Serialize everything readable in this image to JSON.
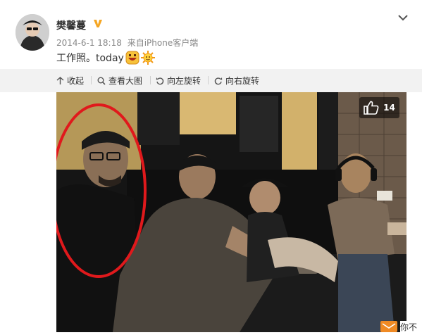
{
  "post": {
    "username": "樊馨蔓",
    "timestamp": "2014-6-1 18:18",
    "source_prefix": "来自",
    "source": "iPhone客户端",
    "text": "工作照。today"
  },
  "toolbar": {
    "collapse": "收起",
    "view_large": "查看大图",
    "rotate_left": "向左旋转",
    "rotate_right": "向右旋转"
  },
  "photo": {
    "like_count": "14"
  },
  "footer": {
    "partial_text": "你不"
  },
  "colors": {
    "vip_badge": "#f5a623",
    "highlight_circle": "#e0191c",
    "toolbar_bg": "#f2f2f2"
  },
  "icons": [
    "avatar",
    "vip-badge-icon",
    "grinning-emoji-icon",
    "sun-emoji-icon",
    "chevron-down-icon",
    "collapse-arrow-icon",
    "magnify-icon",
    "rotate-left-icon",
    "rotate-right-icon",
    "thumbs-up-icon",
    "mail-icon"
  ]
}
